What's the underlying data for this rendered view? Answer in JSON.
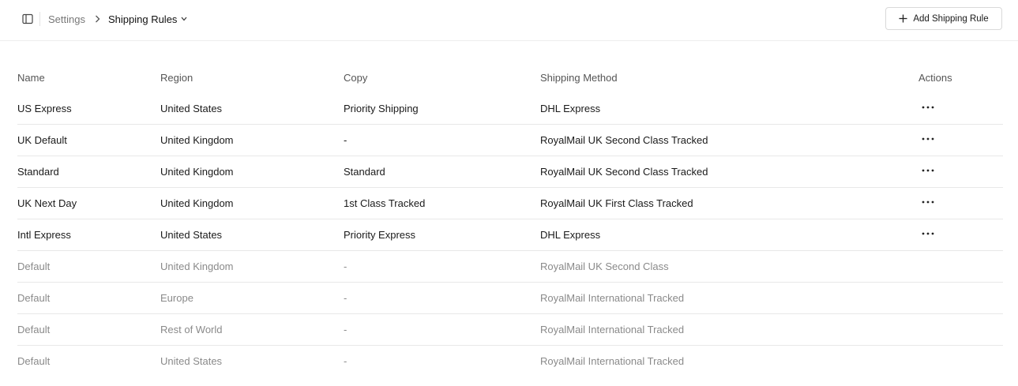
{
  "header": {
    "breadcrumb_root": "Settings",
    "breadcrumb_current": "Shipping Rules",
    "add_button_label": "Add Shipping Rule"
  },
  "table": {
    "columns": [
      "Name",
      "Region",
      "Copy",
      "Shipping Method",
      "Actions"
    ],
    "rows": [
      {
        "name": "US Express",
        "region": "United States",
        "copy": "Priority Shipping",
        "method": "DHL Express",
        "is_default": false
      },
      {
        "name": "UK Default",
        "region": "United Kingdom",
        "copy": "-",
        "method": "RoyalMail UK Second Class Tracked",
        "is_default": false
      },
      {
        "name": "Standard",
        "region": "United Kingdom",
        "copy": "Standard",
        "method": "RoyalMail UK Second Class Tracked",
        "is_default": false
      },
      {
        "name": "UK Next Day",
        "region": "United Kingdom",
        "copy": "1st Class Tracked",
        "method": "RoyalMail UK First Class Tracked",
        "is_default": false
      },
      {
        "name": "Intl Express",
        "region": "United States",
        "copy": "Priority Express",
        "method": "DHL Express",
        "is_default": false
      },
      {
        "name": "Default",
        "region": "United Kingdom",
        "copy": "-",
        "method": "RoyalMail UK Second Class",
        "is_default": true
      },
      {
        "name": "Default",
        "region": "Europe",
        "copy": "-",
        "method": "RoyalMail International Tracked",
        "is_default": true
      },
      {
        "name": "Default",
        "region": "Rest of World",
        "copy": "-",
        "method": "RoyalMail International Tracked",
        "is_default": true
      },
      {
        "name": "Default",
        "region": "United States",
        "copy": "-",
        "method": "RoyalMail International Tracked",
        "is_default": true
      }
    ]
  },
  "icons": {
    "sidebar_toggle": "sidebar-toggle-icon",
    "breadcrumb_separator": "chevron-right-icon",
    "title_dropdown": "chevron-down-icon",
    "add": "plus-icon",
    "row_actions": "more-horizontal-icon"
  },
  "colors": {
    "default_row_text": "#8a8a8a",
    "row_border": "#e8e8e8"
  }
}
